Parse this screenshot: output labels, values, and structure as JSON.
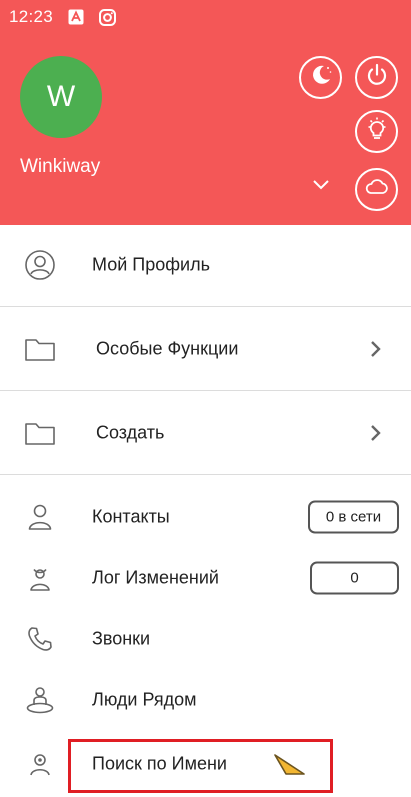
{
  "colors": {
    "header_bg": "#f45757",
    "avatar_bg": "#4caf50",
    "highlight_border": "#e01e24"
  },
  "status_bar": {
    "time": "12:23",
    "icons": [
      "text-a-icon",
      "instagram-icon"
    ]
  },
  "profile": {
    "avatar_letter": "W",
    "username": "Winkiway"
  },
  "header_actions": [
    "night-mode-icon",
    "power-icon",
    "lightbulb-icon",
    "cloud-icon",
    "chevron-down-icon"
  ],
  "menu": {
    "my_profile": "Мой Профиль",
    "special_functions": "Особые Функции",
    "create": "Создать",
    "contacts": "Контакты",
    "contacts_badge": "0 в сети",
    "changelog": "Лог Изменений",
    "changelog_badge": "0",
    "calls": "Звонки",
    "people_nearby": "Люди Рядом",
    "search_by_name": "Поиск по Имени"
  }
}
